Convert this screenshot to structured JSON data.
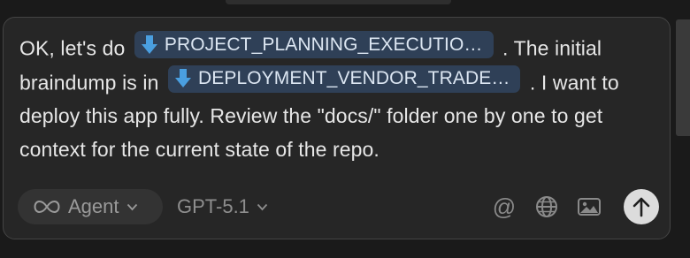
{
  "prompt": {
    "text_1": "OK, let's do ",
    "file_1": "PROJECT_PLANNING_EXECUTIO…",
    "text_2": " . The initial braindump is in ",
    "file_2": "DEPLOYMENT_VENDOR_TRADE…",
    "text_3": " . I want to deploy this app fully. Review the \"docs/\" folder one by one to get context for the current state of the repo."
  },
  "footer": {
    "mode_icon": "infinity-icon",
    "mode_label": "Agent",
    "model_label": "GPT-5.1",
    "mention_label": "@",
    "globe_icon": "globe-icon",
    "image_icon": "image-icon",
    "send_icon": "arrow-up-icon"
  },
  "colors": {
    "background": "#1a1a1a",
    "composer_bg": "#262626",
    "pill_bg": "#2f4057",
    "pill_arrow": "#4a9fe0",
    "send_bg": "#dcdcdc"
  }
}
